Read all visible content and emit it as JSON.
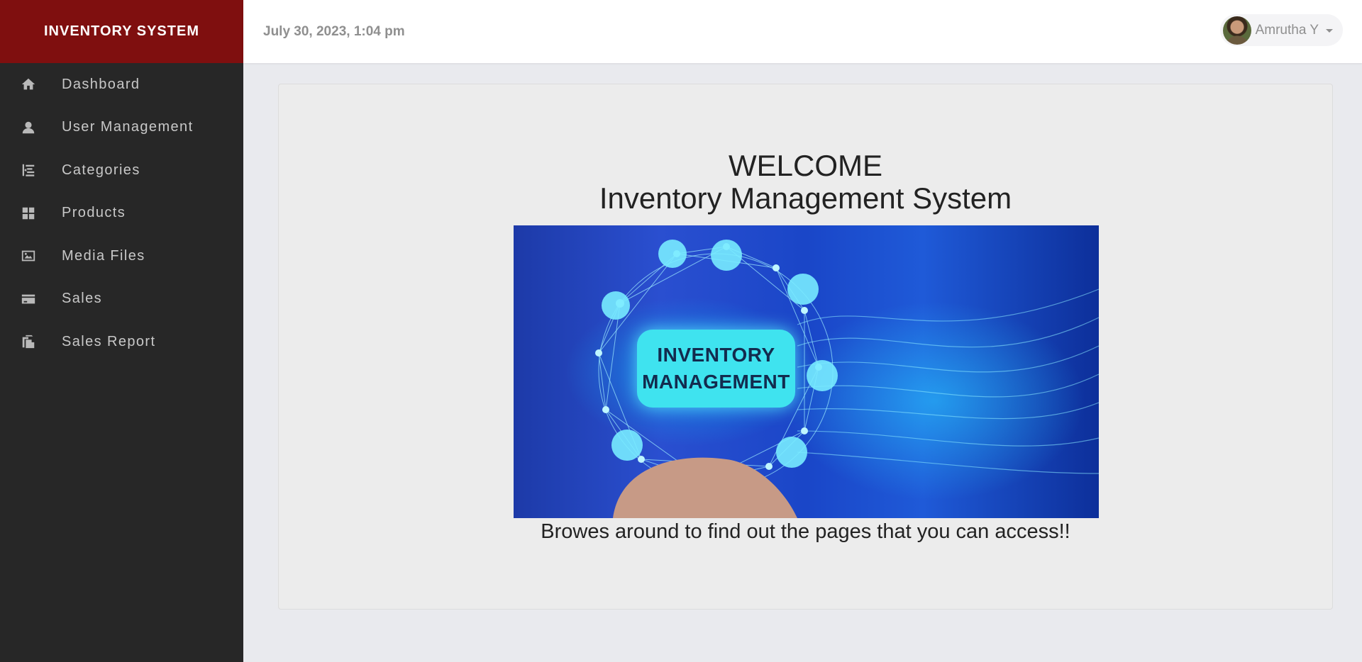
{
  "app": {
    "title": "INVENTORY SYSTEM"
  },
  "header": {
    "date": "July 30, 2023, 1:04 pm",
    "user_name": "Amrutha Y"
  },
  "sidebar": {
    "items": [
      {
        "label": "Dashboard",
        "icon": "home-icon"
      },
      {
        "label": "User Management",
        "icon": "user-icon"
      },
      {
        "label": "Categories",
        "icon": "indent-icon"
      },
      {
        "label": "Products",
        "icon": "grid-icon"
      },
      {
        "label": "Media Files",
        "icon": "picture-icon"
      },
      {
        "label": "Sales",
        "icon": "credit-card-icon"
      },
      {
        "label": "Sales Report",
        "icon": "duplicate-icon"
      }
    ]
  },
  "main": {
    "welcome": "WELCOME",
    "subtitle": "Inventory Management System",
    "image_text": {
      "line1": "INVENTORY",
      "line2": "MANAGEMENT"
    },
    "caption": "Browes around to find out the pages that you can access!!"
  },
  "colors": {
    "brand": "#7f0f0f",
    "sidebar": "#272727",
    "background": "#e9eaee"
  }
}
